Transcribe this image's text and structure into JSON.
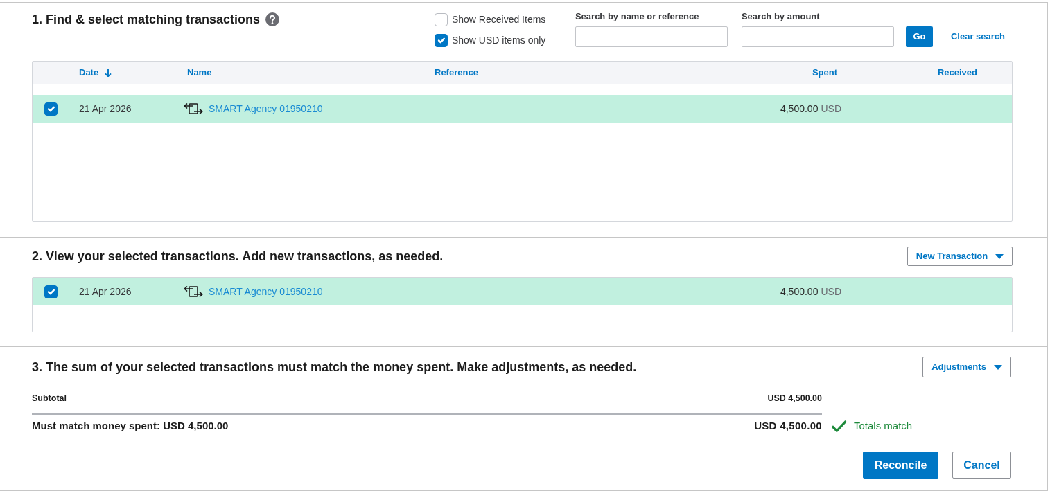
{
  "find_section": {
    "title": "1. Find & select matching transactions",
    "filters": [
      {
        "label": "Show Received Items",
        "checked": false
      },
      {
        "label": "Show USD items only",
        "checked": true
      }
    ],
    "search_fields": [
      {
        "label": "Search by name or reference"
      },
      {
        "label": "Search by amount"
      }
    ],
    "go_button": "Go",
    "clear_search_link": "Clear search",
    "table": {
      "columns": [
        {
          "label": "Date",
          "sorted": true
        },
        {
          "label": "Name",
          "sorted": false
        },
        {
          "label": "Reference",
          "sorted": false
        },
        {
          "label": "Spent",
          "sorted": false
        },
        {
          "label": "Received",
          "sorted": false
        }
      ],
      "rows": [
        {
          "checked": true,
          "date": "21 Apr 2026",
          "name": "SMART Agency 01950210",
          "spent": "4,500.00",
          "currency": "USD"
        }
      ]
    }
  },
  "selected_section": {
    "title": "2. View your selected transactions. Add new transactions, as needed.",
    "new_transaction_button": "New Transaction",
    "rows": [
      {
        "checked": true,
        "date": "21 Apr 2026",
        "name": "SMART Agency 01950210",
        "spent": "4,500.00",
        "currency": "USD"
      }
    ]
  },
  "adjust_section": {
    "title": "3. The sum of your selected transactions must match the money spent. Make adjustments, as needed.",
    "adjustments_button": "Adjustments",
    "subtotal": {
      "label": "Subtotal",
      "value": "USD 4,500.00"
    },
    "target": {
      "label": "Must match money spent: USD 4,500.00",
      "value": "USD 4,500.00"
    },
    "status": {
      "text": "Totals match",
      "matched": true
    },
    "buttons": [
      {
        "label": "Reconcile",
        "kind": "primary"
      },
      {
        "label": "Cancel",
        "kind": "secondary"
      }
    ]
  }
}
